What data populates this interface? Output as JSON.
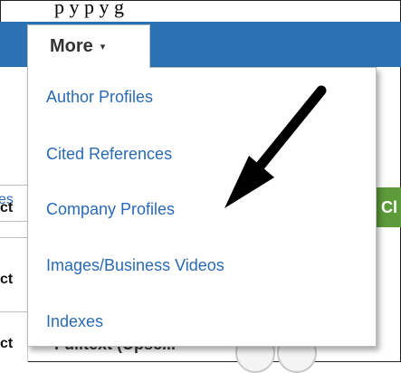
{
  "header_fragment": "p       y   p       y g",
  "more_tab": {
    "label": "More",
    "caret": "▾"
  },
  "menu": {
    "items": [
      {
        "label": "Author Profiles"
      },
      {
        "label": "Cited References"
      },
      {
        "label": "Company Profiles"
      },
      {
        "label": "Images/Business Videos"
      },
      {
        "label": "Indexes"
      }
    ]
  },
  "background": {
    "left_fragments": [
      "es",
      "ct",
      "ct",
      "ct"
    ],
    "green_button_label": "Cl",
    "obscured_text": "Fulltext (Upsc..."
  },
  "colors": {
    "navbar": "#2a72b3",
    "link": "#2a6ab5",
    "green_button": "#5d9a3a",
    "arrow": "#000000"
  },
  "annotation": {
    "arrow_icon": "arrow-pointing-to-company-profiles"
  }
}
